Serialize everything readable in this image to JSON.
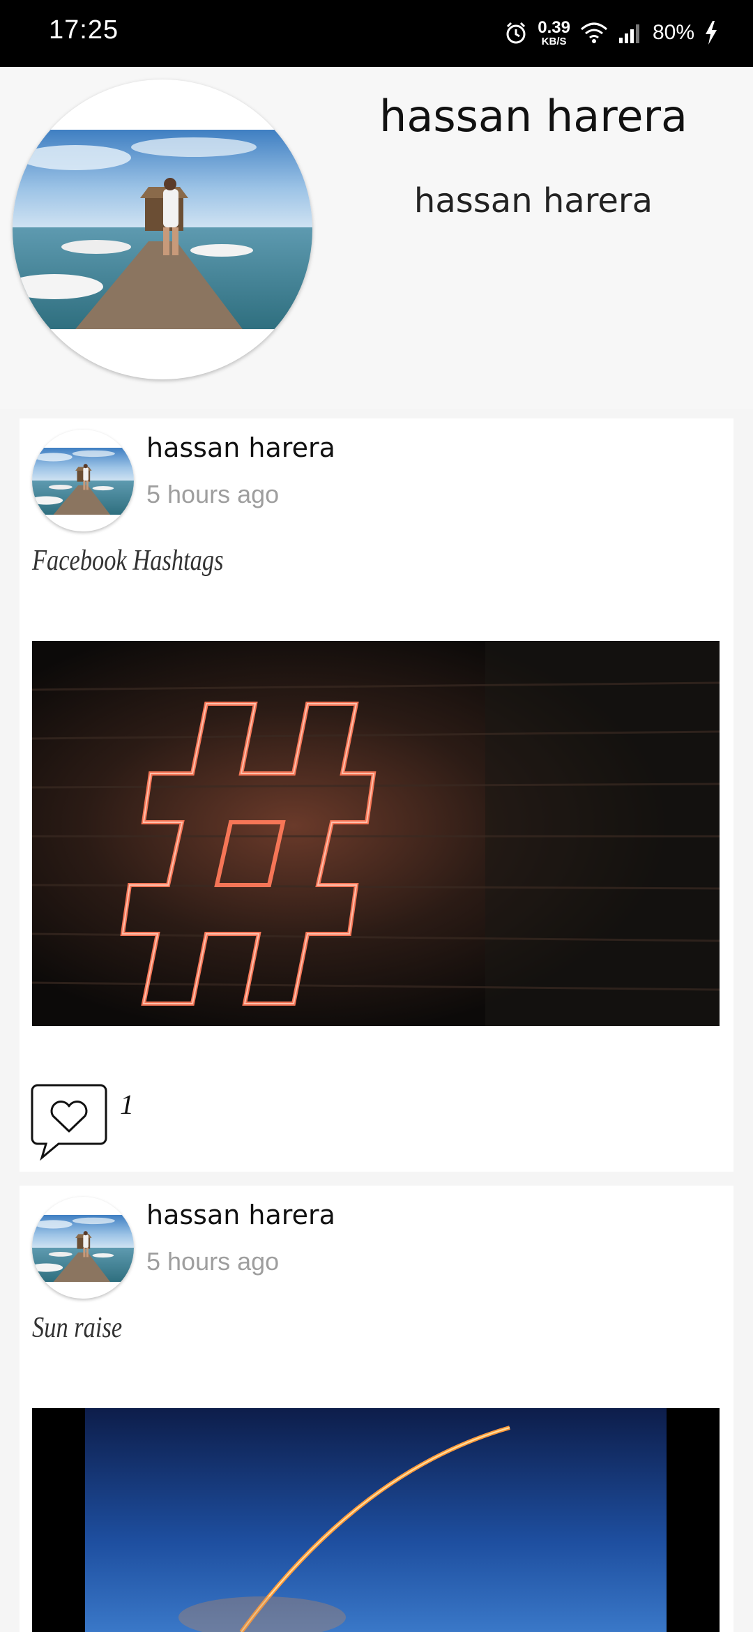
{
  "status_bar": {
    "time": "17:25",
    "net_speed_value": "0.39",
    "net_speed_unit": "KB/S",
    "battery": "80%",
    "icons": [
      "alarm-icon",
      "wifi-icon",
      "signal-icon",
      "charging-icon"
    ]
  },
  "profile": {
    "name": "hassan harera",
    "subtitle": "hassan harera"
  },
  "posts": [
    {
      "author": "hassan harera",
      "time": "5 hours ago",
      "caption": "Facebook Hashtags",
      "likes": "1"
    },
    {
      "author": "hassan harera",
      "time": "5 hours ago",
      "caption": "Sun raise"
    }
  ]
}
